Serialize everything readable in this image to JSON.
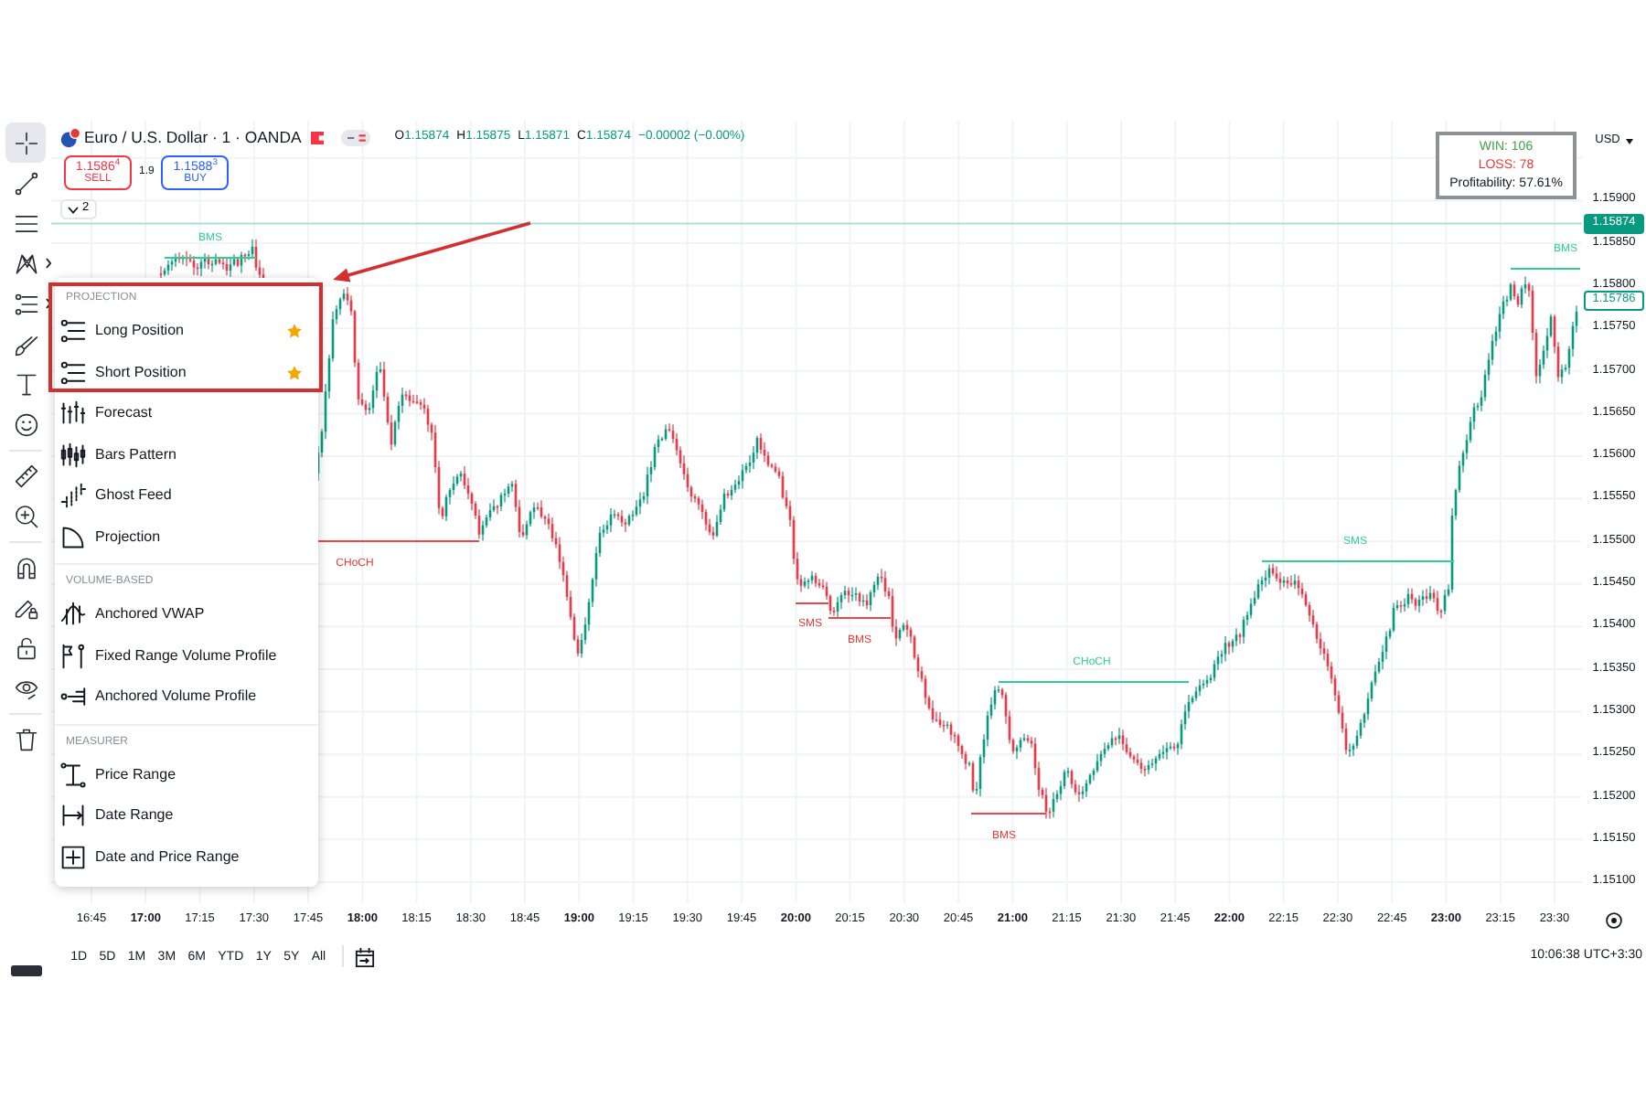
{
  "toolbar": {
    "groups": [
      [
        {
          "selected": true,
          "expanded": false
        },
        {
          "selected": false,
          "expanded": false
        },
        {
          "selected": false,
          "expanded": false
        },
        {
          "selected": false,
          "expanded": true
        },
        {
          "selected": false,
          "expanded": true
        },
        {
          "selected": false,
          "expanded": false
        },
        {
          "selected": false,
          "expanded": false
        },
        {
          "selected": false,
          "expanded": false
        }
      ],
      [
        {
          "selected": false,
          "expanded": false
        },
        {
          "selected": false,
          "expanded": false
        }
      ],
      [
        {
          "selected": false,
          "expanded": false
        },
        {
          "selected": false,
          "expanded": false
        },
        {
          "selected": false,
          "expanded": false
        },
        {
          "selected": false,
          "expanded": false
        }
      ],
      [
        {
          "selected": false,
          "expanded": false
        }
      ]
    ]
  },
  "legend": {
    "symbol": "Euro / U.S. Dollar · 1 · OANDA",
    "rising": true,
    "ohlc": [
      {
        "label": "O",
        "value": "1.15874"
      },
      {
        "label": "H",
        "value": "1.15875"
      },
      {
        "label": "L",
        "value": "1.15871"
      },
      {
        "label": "C",
        "value": "1.15874"
      }
    ],
    "change": "−0.00002 (−0.00%)",
    "sell": {
      "price": "1.1586$^{4}$",
      "label": "SELL"
    },
    "spread": "1.9",
    "buy": {
      "price": "1.1588$^{3}$",
      "label": "BUY"
    },
    "indicators": "2"
  },
  "menu": {
    "sections": [
      {
        "title": "PROJECTION",
        "items": [
          {
            "label": "Long Position",
            "favorite": true
          },
          {
            "label": "Short Position",
            "favorite": true
          },
          {
            "label": "Forecast",
            "favorite": false
          },
          {
            "label": "Bars Pattern",
            "favorite": false
          },
          {
            "label": "Ghost Feed",
            "favorite": false
          },
          {
            "label": "Projection",
            "favorite": false
          }
        ]
      },
      {
        "title": "VOLUME-BASED",
        "items": [
          {
            "label": "Anchored VWAP",
            "favorite": false
          },
          {
            "label": "Fixed Range Volume Profile",
            "favorite": false
          },
          {
            "label": "Anchored Volume Profile",
            "favorite": false
          }
        ]
      },
      {
        "title": "MEASURER",
        "items": [
          {
            "label": "Price Range",
            "favorite": false
          },
          {
            "label": "Date Range",
            "favorite": false
          },
          {
            "label": "Date and Price Range",
            "favorite": false
          }
        ]
      }
    ]
  },
  "stats": [
    {
      "kind": "win",
      "text": "WIN: 106"
    },
    {
      "kind": "loss",
      "text": "LOSS: 78"
    },
    {
      "kind": "ratio",
      "text": "Profitability: 57.61%"
    }
  ],
  "markers": [
    {
      "label": "BMS",
      "kind": "bullish"
    },
    {
      "label": "CHoCH",
      "kind": "bearish"
    },
    {
      "label": "SMS",
      "kind": "bearish"
    },
    {
      "label": "BMS",
      "kind": "bearish"
    },
    {
      "label": "BMS",
      "kind": "bearish"
    },
    {
      "label": "CHoCH",
      "kind": "bullish"
    },
    {
      "label": "SMS",
      "kind": "bullish"
    },
    {
      "label": "BMS",
      "kind": "bullish"
    }
  ],
  "price_axis": {
    "currency": "USD",
    "labels": [
      "1.15900",
      "1.15850",
      "1.15800",
      "1.15750",
      "1.15700",
      "1.15650",
      "1.15600",
      "1.15550",
      "1.15500",
      "1.15450",
      "1.15400",
      "1.15350",
      "1.15300",
      "1.15250",
      "1.15200",
      "1.15150",
      "1.15100"
    ],
    "tags": [
      {
        "text": "1.15874",
        "kind": "filled"
      },
      {
        "text": "1.15786",
        "kind": "outlined"
      }
    ]
  },
  "time_axis": {
    "labels": [
      {
        "text": "16:45",
        "major": false
      },
      {
        "text": "17:00",
        "major": true
      },
      {
        "text": "17:15",
        "major": false
      },
      {
        "text": "17:30",
        "major": false
      },
      {
        "text": "17:45",
        "major": false
      },
      {
        "text": "18:00",
        "major": true
      },
      {
        "text": "18:15",
        "major": false
      },
      {
        "text": "18:30",
        "major": false
      },
      {
        "text": "18:45",
        "major": false
      },
      {
        "text": "19:00",
        "major": true
      },
      {
        "text": "19:15",
        "major": false
      },
      {
        "text": "19:30",
        "major": false
      },
      {
        "text": "19:45",
        "major": false
      },
      {
        "text": "20:00",
        "major": true
      },
      {
        "text": "20:15",
        "major": false
      },
      {
        "text": "20:30",
        "major": false
      },
      {
        "text": "20:45",
        "major": false
      },
      {
        "text": "21:00",
        "major": true
      },
      {
        "text": "21:15",
        "major": false
      },
      {
        "text": "21:30",
        "major": false
      },
      {
        "text": "21:45",
        "major": false
      },
      {
        "text": "22:00",
        "major": true
      },
      {
        "text": "22:15",
        "major": false
      },
      {
        "text": "22:30",
        "major": false
      },
      {
        "text": "22:45",
        "major": false
      },
      {
        "text": "23:00",
        "major": true
      },
      {
        "text": "23:15",
        "major": false
      },
      {
        "text": "23:30",
        "major": false
      }
    ]
  },
  "range_bar": {
    "ranges": [
      {
        "label": "1D",
        "selected": false
      },
      {
        "label": "5D",
        "selected": false
      },
      {
        "label": "1M",
        "selected": false
      },
      {
        "label": "3M",
        "selected": false
      },
      {
        "label": "6M",
        "selected": false
      },
      {
        "label": "YTD",
        "selected": false
      },
      {
        "label": "1Y",
        "selected": false
      },
      {
        "label": "5Y",
        "selected": false
      },
      {
        "label": "All",
        "selected": false
      }
    ],
    "clock": "10:06:38 UTC+3:30"
  }
}
